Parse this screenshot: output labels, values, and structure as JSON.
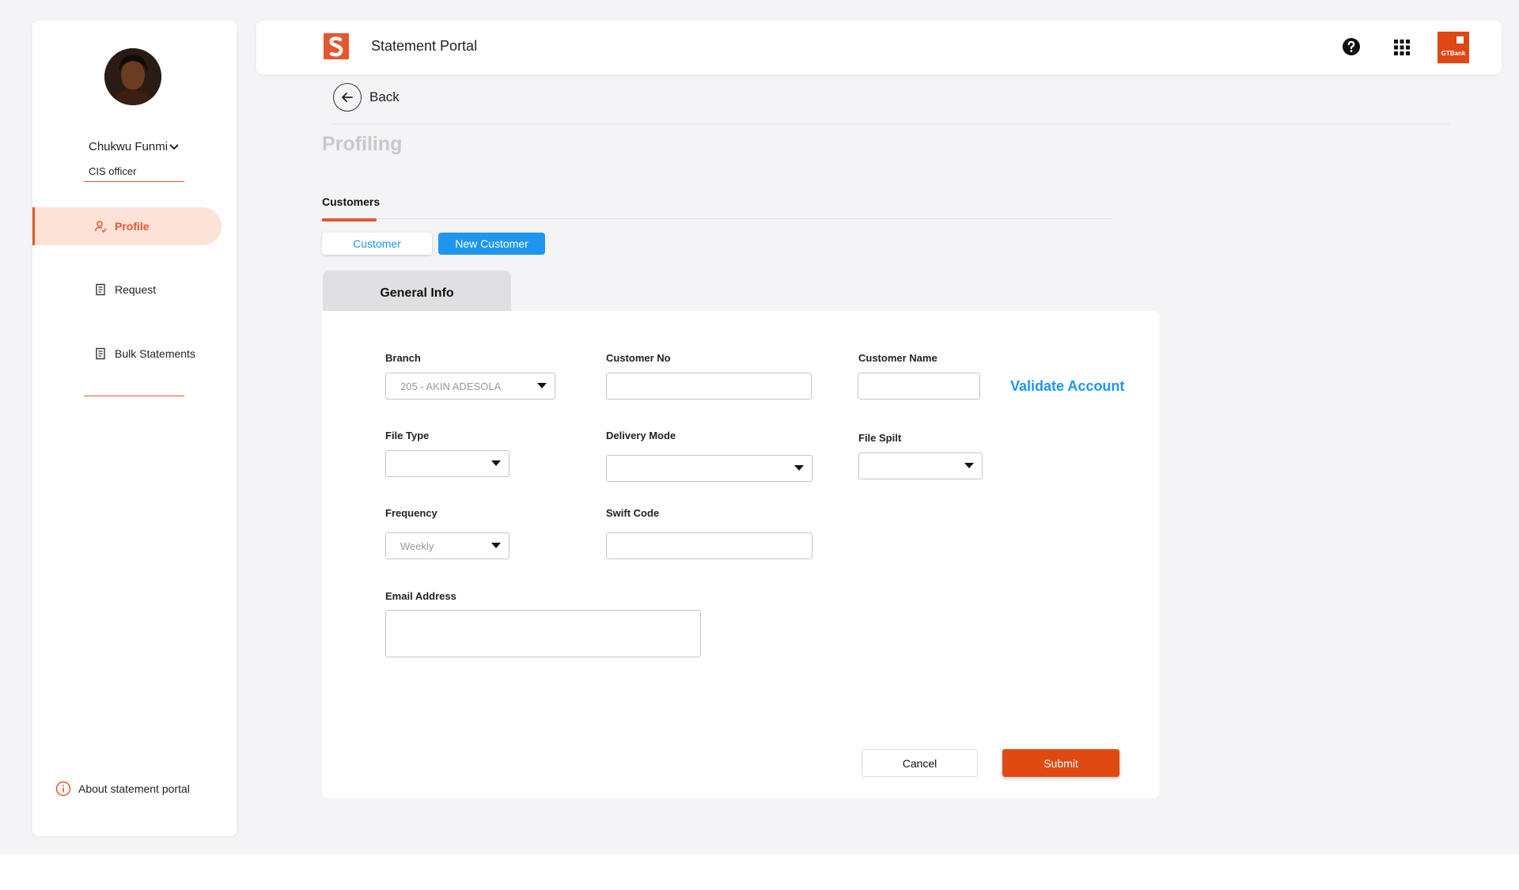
{
  "app": {
    "title": "Statement Portal",
    "brand_logo_text": "GTBank"
  },
  "user": {
    "name": "Chukwu Funmi",
    "role": "CIS officer"
  },
  "sidebar": {
    "items": [
      {
        "label": "Profile",
        "icon": "user-icon",
        "active": true
      },
      {
        "label": "Request",
        "icon": "document-icon",
        "active": false
      },
      {
        "label": "Bulk Statements",
        "icon": "document-icon",
        "active": false
      }
    ],
    "about_label": "About statement portal"
  },
  "header_icons": [
    "help-icon",
    "apps-grid-icon"
  ],
  "nav": {
    "back_label": "Back"
  },
  "page": {
    "title": "Profiling"
  },
  "tabs": {
    "main": "Customers",
    "segments": [
      "Customer",
      "New Customer"
    ],
    "active_segment": "New Customer"
  },
  "form": {
    "section_tab": "General Info",
    "branch": {
      "label": "Branch",
      "value": "205 - AKIN ADESOLA"
    },
    "customer_no": {
      "label": "Customer No",
      "value": ""
    },
    "customer_name": {
      "label": "Customer Name",
      "value": ""
    },
    "validate_label": "Validate Account",
    "file_type": {
      "label": "File Type",
      "value": ""
    },
    "delivery_mode": {
      "label": "Delivery Mode",
      "value": ""
    },
    "file_split": {
      "label": "File Spilt",
      "value": ""
    },
    "frequency": {
      "label": "Frequency",
      "value": "Weekly"
    },
    "swift_code": {
      "label": "Swift Code",
      "value": ""
    },
    "email": {
      "label": "Email Address",
      "value": ""
    },
    "cancel_label": "Cancel",
    "submit_label": "Submit"
  },
  "colors": {
    "accent": "#e4572e",
    "primary_blue": "#1e96f0",
    "submit": "#e0490f",
    "active_nav_bg": "#fde2d7"
  }
}
